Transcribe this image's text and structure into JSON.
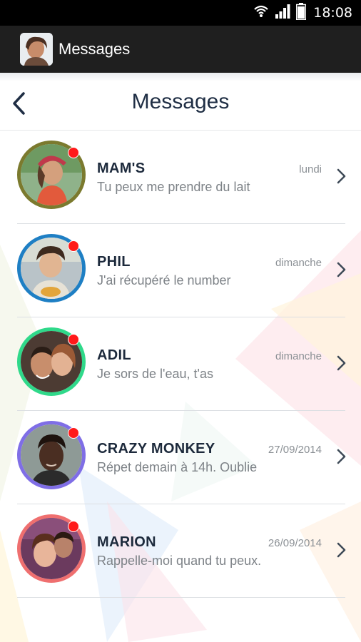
{
  "status_bar": {
    "time": "18:08",
    "icons": [
      "wifi-icon",
      "signal-icon",
      "battery-icon"
    ]
  },
  "action_bar": {
    "title": "Messages",
    "app_icon": "app-avatar-icon",
    "background": "#1f1f1f"
  },
  "header": {
    "title": "Messages",
    "back_icon": "chevron-left-icon",
    "accent": "#1f2e44"
  },
  "conversations": [
    {
      "name": "MAM'S",
      "date": "lundi",
      "preview": "Tu peux me prendre du lait",
      "ring_color": "#7b7a2e",
      "unread": true
    },
    {
      "name": "PHIL",
      "date": "dimanche",
      "preview": "J'ai récupéré le number",
      "ring_color": "#1e7fc4",
      "unread": true
    },
    {
      "name": "ADIL",
      "date": "dimanche",
      "preview": "Je sors de l'eau, t'as",
      "ring_color": "#2fd98a",
      "unread": true
    },
    {
      "name": "CRAZY MONKEY",
      "date": "27/09/2014",
      "preview": "Répet demain à 14h. Oublie",
      "ring_color": "#7f6ee6",
      "unread": true
    },
    {
      "name": "MARION",
      "date": "26/09/2014",
      "preview": "Rappelle-moi quand tu peux.",
      "ring_color": "#ef6f6f",
      "unread": true
    }
  ],
  "colors": {
    "unread_dot": "#ff1a1a",
    "name_text": "#1d2a3c",
    "secondary_text": "#7d8287"
  }
}
